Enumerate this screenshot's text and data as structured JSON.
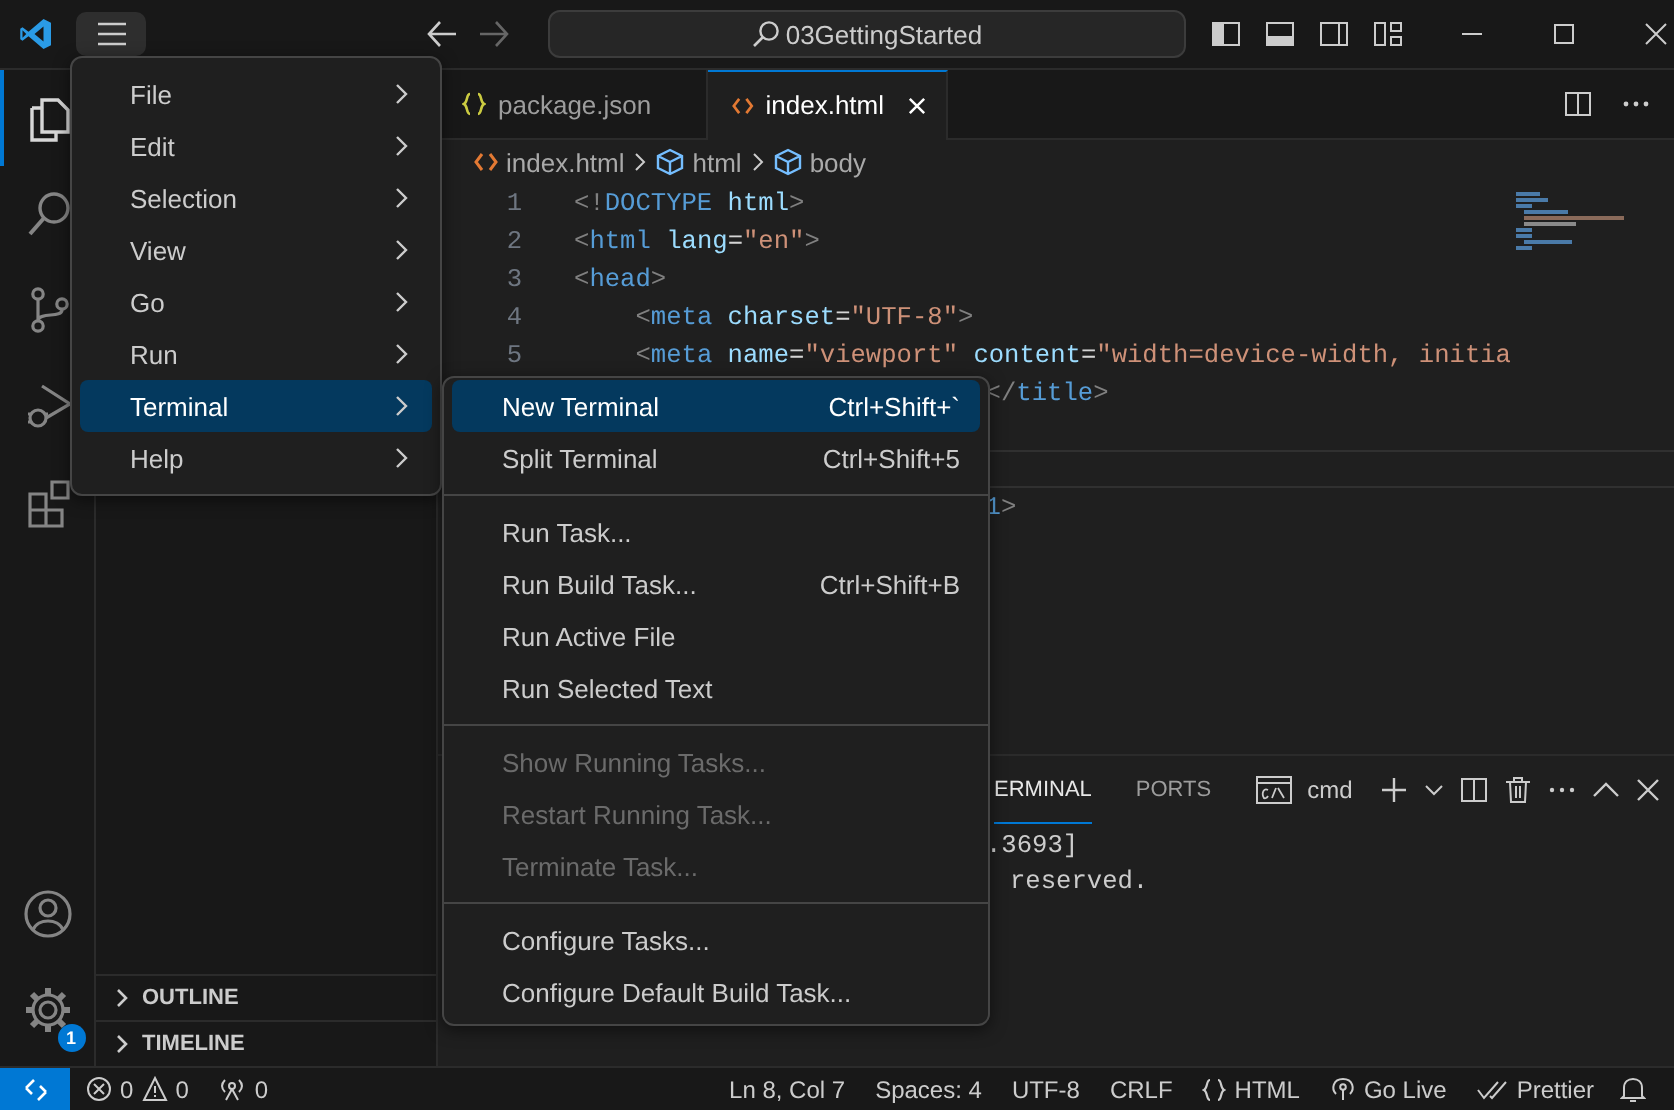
{
  "titlebar": {
    "search": "03GettingStarted"
  },
  "activity_bar": {
    "items": [
      {
        "kind": "explorer",
        "selected": true
      },
      {
        "kind": "search",
        "selected": false
      },
      {
        "kind": "source-control",
        "selected": false
      },
      {
        "kind": "run-debug",
        "selected": false
      },
      {
        "kind": "extensions",
        "selected": false
      }
    ],
    "settings_badge": "1"
  },
  "sidebar": {
    "sections": [
      {
        "label": "OUTLINE",
        "expanded": false
      },
      {
        "label": "TIMELINE",
        "expanded": false
      }
    ]
  },
  "tabs": [
    {
      "label": "package.json",
      "kind": "json",
      "selected": false
    },
    {
      "label": "index.html",
      "kind": "html",
      "selected": true
    }
  ],
  "breadcrumb": [
    {
      "label": "index.html",
      "kind": "file"
    },
    {
      "label": "html",
      "kind": "element"
    },
    {
      "label": "body",
      "kind": "element"
    }
  ],
  "editor": {
    "lines": [
      {
        "number": "1",
        "tokens": [
          {
            "text": "<!",
            "kind": "punct"
          },
          {
            "text": "DOCTYPE",
            "kind": "tag"
          },
          {
            "text": " html",
            "kind": "attr"
          },
          {
            "text": ">",
            "kind": "punct"
          }
        ]
      },
      {
        "number": "2",
        "tokens": [
          {
            "text": "<",
            "kind": "punct"
          },
          {
            "text": "html",
            "kind": "tag"
          },
          {
            "text": " lang",
            "kind": "attr"
          },
          {
            "text": "=",
            "kind": "plain"
          },
          {
            "text": "\"en\"",
            "kind": "string"
          },
          {
            "text": ">",
            "kind": "punct"
          }
        ]
      },
      {
        "number": "3",
        "tokens": [
          {
            "text": "<",
            "kind": "punct"
          },
          {
            "text": "head",
            "kind": "tag"
          },
          {
            "text": ">",
            "kind": "punct"
          }
        ]
      },
      {
        "number": "4",
        "tokens": [
          {
            "text": "    <",
            "kind": "punct"
          },
          {
            "text": "meta",
            "kind": "tag"
          },
          {
            "text": " charset",
            "kind": "attr"
          },
          {
            "text": "=",
            "kind": "plain"
          },
          {
            "text": "\"UTF-8\"",
            "kind": "string"
          },
          {
            "text": ">",
            "kind": "punct"
          }
        ]
      },
      {
        "number": "5",
        "tokens": [
          {
            "text": "    <",
            "kind": "punct"
          },
          {
            "text": "meta",
            "kind": "tag"
          },
          {
            "text": " name",
            "kind": "attr"
          },
          {
            "text": "=",
            "kind": "plain"
          },
          {
            "text": "\"viewport\"",
            "kind": "string"
          },
          {
            "text": " content",
            "kind": "attr"
          },
          {
            "text": "=",
            "kind": "plain"
          },
          {
            "text": "\"width=device-width, initia",
            "kind": "string"
          }
        ]
      },
      {
        "tokens": [
          {
            "text": "</",
            "kind": "punct"
          },
          {
            "text": "title",
            "kind": "tag"
          },
          {
            "text": ">",
            "kind": "punct"
          }
        ]
      }
    ],
    "lines_below": [
      {
        "tokens": [
          {
            "text": "1",
            "kind": "tag"
          },
          {
            "text": ">",
            "kind": "punct"
          }
        ]
      }
    ]
  },
  "panel": {
    "tabs": [
      {
        "label": "ERMINAL",
        "selected": true
      },
      {
        "label": "PORTS",
        "selected": false
      }
    ],
    "terminal_name": "cmd",
    "terminal_lines": [
      ".3693]",
      "reserved."
    ]
  },
  "menu": {
    "items": [
      {
        "label": "File",
        "selected": false
      },
      {
        "label": "Edit",
        "selected": false
      },
      {
        "label": "Selection",
        "selected": false
      },
      {
        "label": "View",
        "selected": false
      },
      {
        "label": "Go",
        "selected": false
      },
      {
        "label": "Run",
        "selected": false
      },
      {
        "label": "Terminal",
        "selected": true
      },
      {
        "label": "Help",
        "selected": false
      }
    ]
  },
  "submenu": {
    "items": [
      {
        "kind": "item",
        "label": "New Terminal",
        "shortcut": "Ctrl+Shift+`",
        "selected": true,
        "disabled": false
      },
      {
        "kind": "item",
        "label": "Split Terminal",
        "shortcut": "Ctrl+Shift+5",
        "selected": false,
        "disabled": false
      },
      {
        "kind": "separator"
      },
      {
        "kind": "item",
        "label": "Run Task...",
        "selected": false,
        "disabled": false
      },
      {
        "kind": "item",
        "label": "Run Build Task...",
        "shortcut": "Ctrl+Shift+B",
        "selected": false,
        "disabled": false
      },
      {
        "kind": "item",
        "label": "Run Active File",
        "selected": false,
        "disabled": false
      },
      {
        "kind": "item",
        "label": "Run Selected Text",
        "selected": false,
        "disabled": false
      },
      {
        "kind": "separator"
      },
      {
        "kind": "item",
        "label": "Show Running Tasks...",
        "selected": false,
        "disabled": true
      },
      {
        "kind": "item",
        "label": "Restart Running Task...",
        "selected": false,
        "disabled": true
      },
      {
        "kind": "item",
        "label": "Terminate Task...",
        "selected": false,
        "disabled": true
      },
      {
        "kind": "separator"
      },
      {
        "kind": "item",
        "label": "Configure Tasks...",
        "selected": false,
        "disabled": false
      },
      {
        "kind": "item",
        "label": "Configure Default Build Task...",
        "selected": false,
        "disabled": false
      }
    ]
  },
  "status_bar": {
    "errors": "0",
    "warnings": "0",
    "ports": "0",
    "right": [
      {
        "label": "Ln 8, Col 7",
        "kind": "text"
      },
      {
        "label": "Spaces: 4",
        "kind": "text"
      },
      {
        "label": "UTF-8",
        "kind": "text"
      },
      {
        "label": "CRLF",
        "kind": "text"
      },
      {
        "label": "HTML",
        "kind": "language"
      },
      {
        "label": "Go Live",
        "kind": "live"
      },
      {
        "label": "Prettier",
        "kind": "formatter"
      }
    ]
  }
}
